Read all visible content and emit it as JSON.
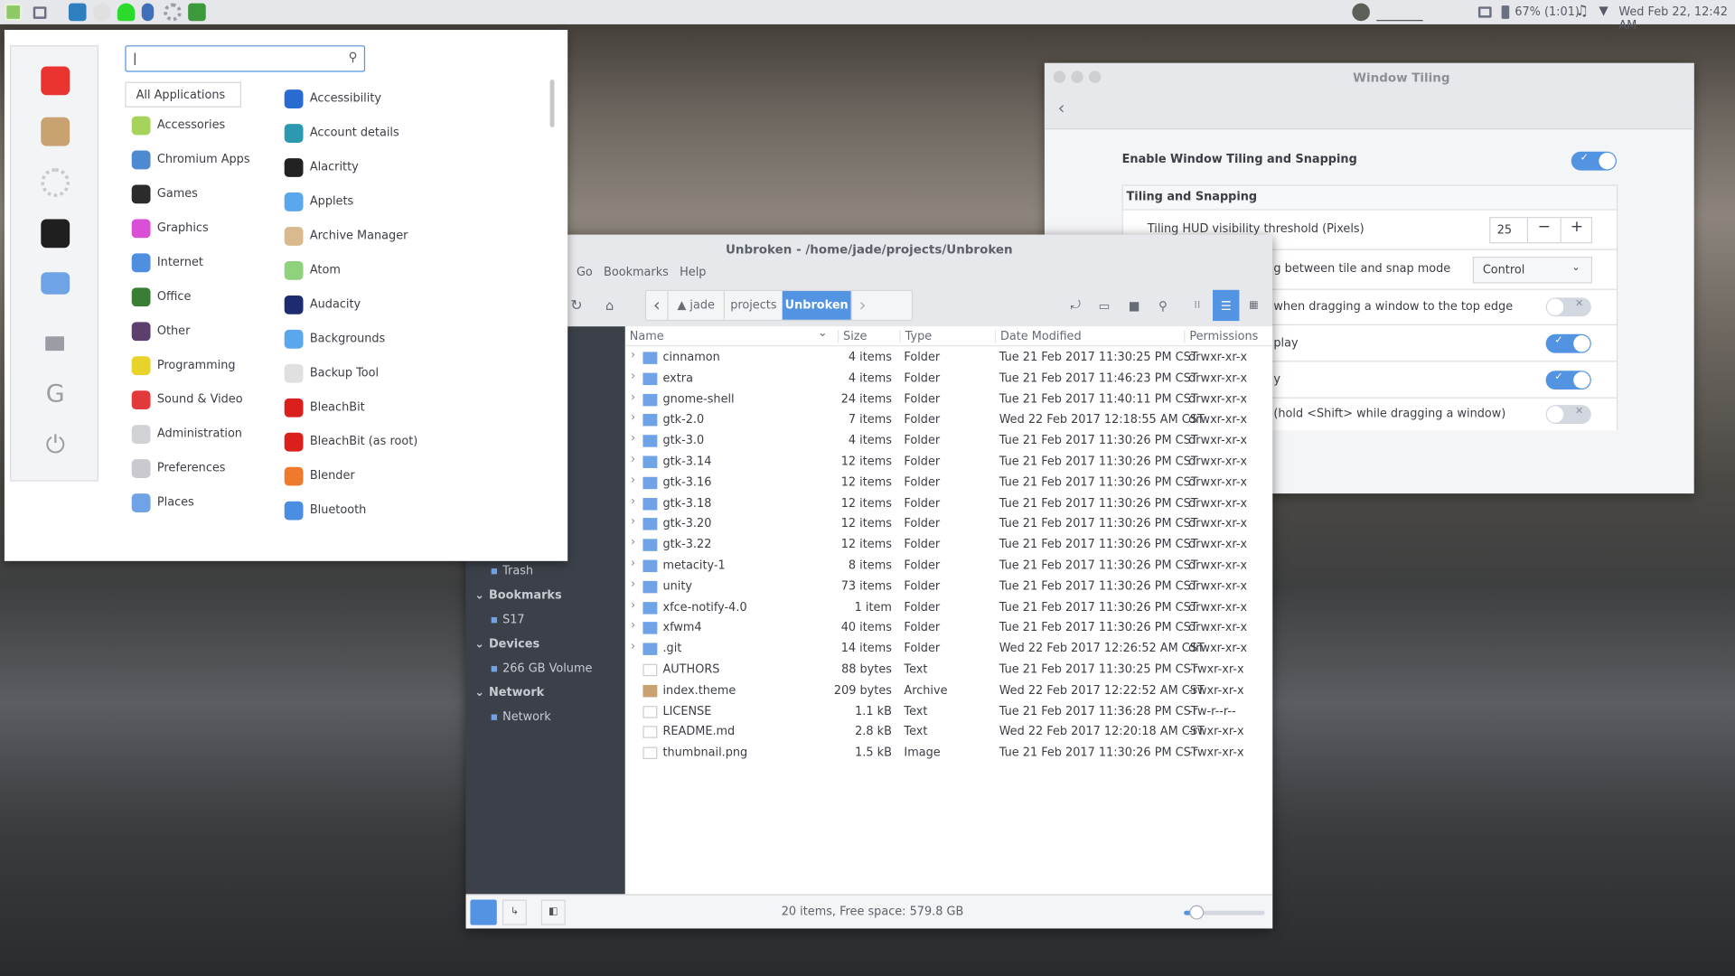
{
  "panel": {
    "battery": "67% (1:01)",
    "clock": "Wed Feb 22, 12:42 AM"
  },
  "menu": {
    "search_value": "|",
    "all_applications": "All Applications",
    "categories": [
      "Accessories",
      "Chromium Apps",
      "Games",
      "Graphics",
      "Internet",
      "Office",
      "Other",
      "Programming",
      "Sound & Video",
      "Administration",
      "Preferences",
      "Places"
    ],
    "category_colors": [
      "#a6d35b",
      "#4e8ad0",
      "#2b2b2b",
      "#d94fd6",
      "#4f8fe0",
      "#3a7d34",
      "#5d3f6e",
      "#e8d32a",
      "#e2393b",
      "#d0d2d6",
      "#c9c9cf",
      "#6fa3e6"
    ],
    "apps": [
      "Accessibility",
      "Account details",
      "Alacritty",
      "Applets",
      "Archive Manager",
      "Atom",
      "Audacity",
      "Backgrounds",
      "Backup Tool",
      "BleachBit",
      "BleachBit (as root)",
      "Blender",
      "Bluetooth"
    ],
    "app_colors": [
      "#2a6bd1",
      "#2b9ab0",
      "#222222",
      "#5aa7ee",
      "#d9b98e",
      "#8fd17d",
      "#1d2b6f",
      "#5aa7ee",
      "#e0e0e0",
      "#d9201d",
      "#d9201d",
      "#ee7a2e",
      "#4b8de0"
    ]
  },
  "tiling": {
    "title": "Window Tiling",
    "enable_label": "Enable Window Tiling and Snapping",
    "enable_on": true,
    "section": "Tiling and Snapping",
    "hud_label": "Tiling HUD visibility threshold (Pixels)",
    "hud_value": "25",
    "mode_label": "g between tile and snap mode",
    "mode_value": "Control",
    "rows": [
      {
        "label": "when dragging a window to the top edge",
        "on": false
      },
      {
        "label": "play",
        "on": true
      },
      {
        "label": "y",
        "on": true
      },
      {
        "label": "(hold <Shift> while dragging a window)",
        "on": false
      }
    ]
  },
  "files": {
    "title": "Unbroken - /home/jade/projects/Unbroken",
    "menu": [
      "Go",
      "Bookmarks",
      "Help"
    ],
    "crumbs": [
      "jade",
      "projects",
      "Unbroken"
    ],
    "columns": [
      "Name",
      "Size",
      "Type",
      "Date Modified",
      "Permissions"
    ],
    "sidebar": [
      {
        "label": "Trash",
        "h": false
      },
      {
        "label": "Bookmarks",
        "h": true
      },
      {
        "label": "S17",
        "h": false
      },
      {
        "label": "Devices",
        "h": true
      },
      {
        "label": "266 GB Volume",
        "h": false
      },
      {
        "label": "Network",
        "h": true
      },
      {
        "label": "Network",
        "h": false
      }
    ],
    "rows": [
      [
        "cinnamon",
        "4 items",
        "Folder",
        "Tue 21 Feb 2017 11:30:25 PM CST",
        "drwxr-xr-x"
      ],
      [
        "extra",
        "4 items",
        "Folder",
        "Tue 21 Feb 2017 11:46:23 PM CST",
        "drwxr-xr-x"
      ],
      [
        "gnome-shell",
        "24 items",
        "Folder",
        "Tue 21 Feb 2017 11:40:11 PM CST",
        "drwxr-xr-x"
      ],
      [
        "gtk-2.0",
        "7 items",
        "Folder",
        "Wed 22 Feb 2017 12:18:55 AM CST",
        "drwxr-xr-x"
      ],
      [
        "gtk-3.0",
        "4 items",
        "Folder",
        "Tue 21 Feb 2017 11:30:26 PM CST",
        "drwxr-xr-x"
      ],
      [
        "gtk-3.14",
        "12 items",
        "Folder",
        "Tue 21 Feb 2017 11:30:26 PM CST",
        "drwxr-xr-x"
      ],
      [
        "gtk-3.16",
        "12 items",
        "Folder",
        "Tue 21 Feb 2017 11:30:26 PM CST",
        "drwxr-xr-x"
      ],
      [
        "gtk-3.18",
        "12 items",
        "Folder",
        "Tue 21 Feb 2017 11:30:26 PM CST",
        "drwxr-xr-x"
      ],
      [
        "gtk-3.20",
        "12 items",
        "Folder",
        "Tue 21 Feb 2017 11:30:26 PM CST",
        "drwxr-xr-x"
      ],
      [
        "gtk-3.22",
        "12 items",
        "Folder",
        "Tue 21 Feb 2017 11:30:26 PM CST",
        "drwxr-xr-x"
      ],
      [
        "metacity-1",
        "8 items",
        "Folder",
        "Tue 21 Feb 2017 11:30:26 PM CST",
        "drwxr-xr-x"
      ],
      [
        "unity",
        "73 items",
        "Folder",
        "Tue 21 Feb 2017 11:30:26 PM CST",
        "drwxr-xr-x"
      ],
      [
        "xfce-notify-4.0",
        "1 item",
        "Folder",
        "Tue 21 Feb 2017 11:30:26 PM CST",
        "drwxr-xr-x"
      ],
      [
        "xfwm4",
        "40 items",
        "Folder",
        "Tue 21 Feb 2017 11:30:26 PM CST",
        "drwxr-xr-x"
      ],
      [
        ".git",
        "14 items",
        "Folder",
        "Wed 22 Feb 2017 12:26:52 AM CST",
        "drwxr-xr-x"
      ],
      [
        "AUTHORS",
        "88 bytes",
        "Text",
        "Tue 21 Feb 2017 11:30:25 PM CST",
        "-rwxr-xr-x"
      ],
      [
        "index.theme",
        "209 bytes",
        "Archive",
        "Wed 22 Feb 2017 12:22:52 AM CST",
        "-rwxr-xr-x"
      ],
      [
        "LICENSE",
        "1.1 kB",
        "Text",
        "Tue 21 Feb 2017 11:36:28 PM CST",
        "-rw-r--r--"
      ],
      [
        "README.md",
        "2.8 kB",
        "Text",
        "Wed 22 Feb 2017 12:20:18 AM CST",
        "-rwxr-xr-x"
      ],
      [
        "thumbnail.png",
        "1.5 kB",
        "Image",
        "Tue 21 Feb 2017 11:30:26 PM CST",
        "-rwxr-xr-x"
      ]
    ],
    "status": "20 items, Free space: 579.8 GB",
    "zoom_level": 0.1
  },
  "colors": {
    "accent": "#5294e2",
    "sidebar": "#3c4049"
  }
}
